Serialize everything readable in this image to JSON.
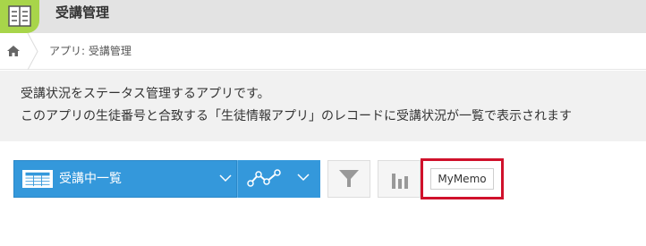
{
  "header": {
    "app_title": "受講管理",
    "app_icon": "app-list-icon",
    "accent_color": "#a8d54a"
  },
  "breadcrumb": {
    "home_icon": "home-icon",
    "current": "アプリ: 受講管理"
  },
  "description": {
    "line1": "受講状況をステータス管理するアプリです。",
    "line2": "このアプリの生徒番号と合致する「生徒情報アプリ」のレコードに受講状況が一覧で表示されます"
  },
  "toolbar": {
    "view_name": "受講中一覧",
    "view_icon": "table-icon",
    "graph_icon": "line-graph-icon",
    "filter_icon": "filter-icon",
    "chart_icon": "bar-chart-icon",
    "custom_button_label": "MyMemo",
    "primary_color": "#3498db",
    "highlight_color": "#d0112b"
  }
}
